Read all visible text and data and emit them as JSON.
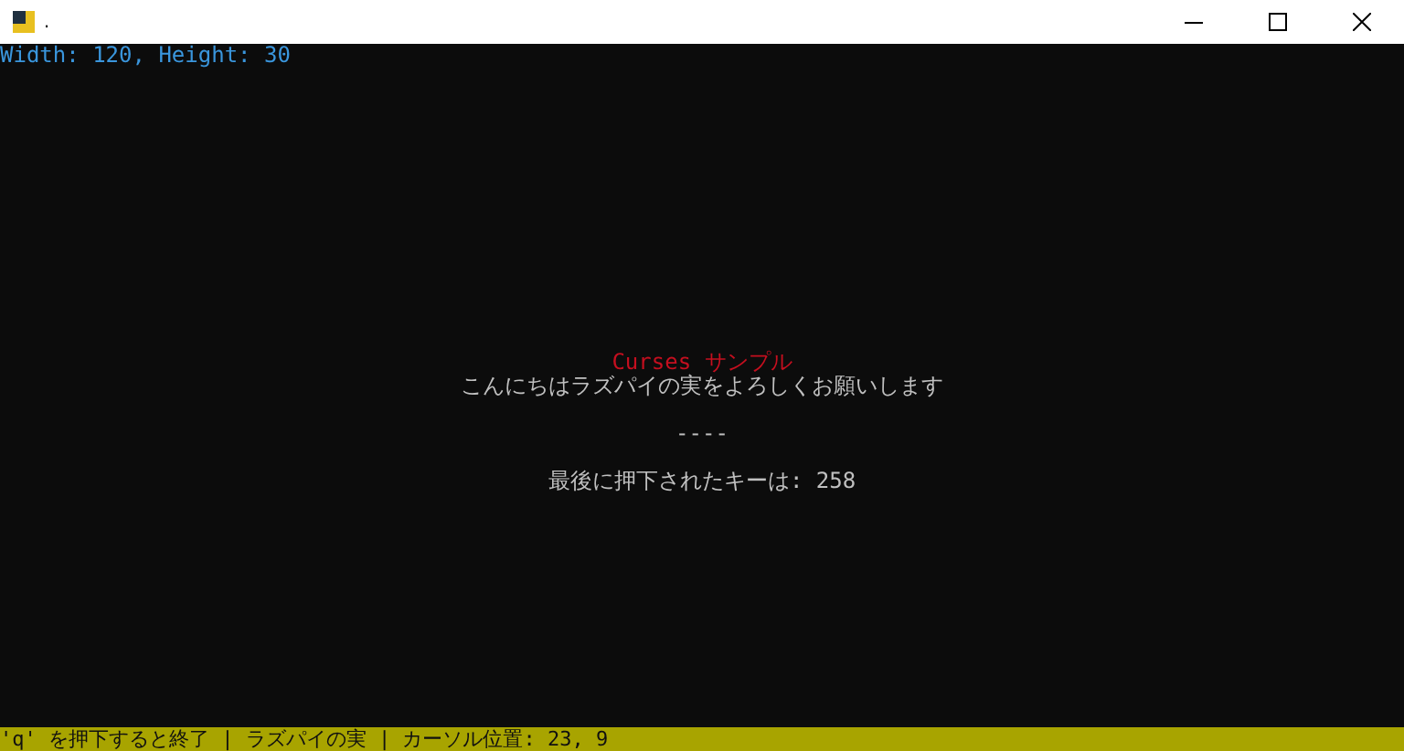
{
  "window": {
    "title": "."
  },
  "terminal": {
    "size_line": "Width: 120, Height: 30",
    "title": "Curses サンプル",
    "greeting": "こんにちはラズパイの実をよろしくお願いします",
    "separator": "----",
    "last_key": "最後に押下されたキーは: 258"
  },
  "status_bar": "'q' を押下すると終了 | ラズパイの実 | カーソル位置: 23, 9"
}
